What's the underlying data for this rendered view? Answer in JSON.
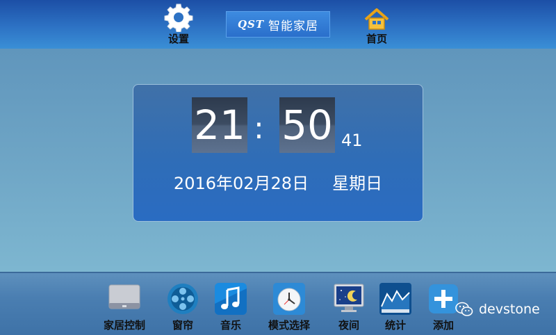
{
  "header": {
    "settings_label": "设置",
    "brand_en": "QST",
    "brand_cn": "智能家居",
    "home_label": "首页"
  },
  "clock": {
    "hours": "21",
    "separator": ":",
    "minutes": "50",
    "seconds": "41",
    "date": "2016年02月28日",
    "weekday": "星期日"
  },
  "dock": {
    "items": [
      {
        "label": "家居控制",
        "icon": "monitor-icon"
      },
      {
        "label": "窗帘",
        "icon": "film-reel-icon"
      },
      {
        "label": "音乐",
        "icon": "music-note-icon"
      },
      {
        "label": "模式选择",
        "icon": "clock-icon"
      },
      {
        "label": "夜间",
        "icon": "night-moon-icon"
      },
      {
        "label": "统计",
        "icon": "chart-icon"
      },
      {
        "label": "添加",
        "icon": "plus-icon"
      }
    ]
  },
  "watermark": {
    "text": "devstone",
    "icon": "wechat-icon"
  },
  "colors": {
    "topbar": "#2d72c4",
    "panel": "#2f6db7",
    "dock": "#4a7eb1"
  }
}
